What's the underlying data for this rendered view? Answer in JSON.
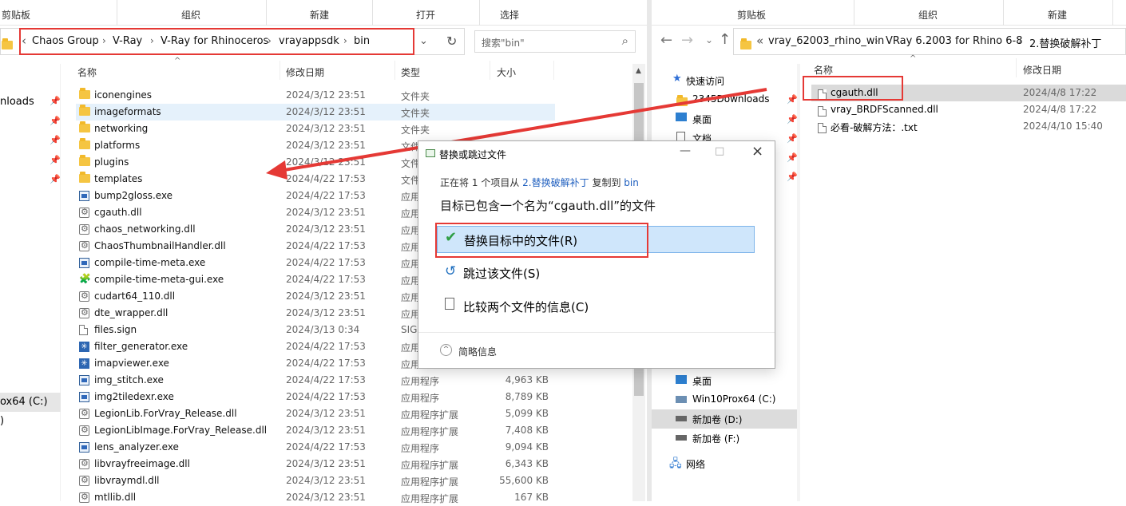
{
  "left_ribbon": {
    "clipboard": "剪贴板",
    "organize": "组织",
    "new": "新建",
    "open": "打开",
    "select": "选择"
  },
  "left_address": {
    "back": "‹",
    "items": [
      "Chaos Group",
      "V-Ray",
      "V-Ray for Rhinoceros",
      "vrayappsdk",
      "bin"
    ],
    "search_placeholder": "搜索\"bin\""
  },
  "left_headers": {
    "name": "名称",
    "date": "修改日期",
    "type": "类型",
    "size": "大小"
  },
  "left_nav": {
    "downloads": "nloads",
    "drive": "ox64 (C:)",
    "paren": ")"
  },
  "left_files": [
    {
      "name": "iconengines",
      "date": "2024/3/12 23:51",
      "type": "文件夹",
      "size": "",
      "icon": "folder-icon"
    },
    {
      "name": "imageformats",
      "date": "2024/3/12 23:51",
      "type": "文件夹",
      "size": "",
      "icon": "folder-icon"
    },
    {
      "name": "networking",
      "date": "2024/3/12 23:51",
      "type": "文件夹",
      "size": "",
      "icon": "folder-icon"
    },
    {
      "name": "platforms",
      "date": "2024/3/12 23:51",
      "type": "文件夹",
      "size": "",
      "icon": "folder-icon"
    },
    {
      "name": "plugins",
      "date": "2024/3/12 23:51",
      "type": "文件夹",
      "size": "",
      "icon": "folder-icon"
    },
    {
      "name": "templates",
      "date": "2024/4/22 17:53",
      "type": "文件",
      "size": "",
      "icon": "folder-icon"
    },
    {
      "name": "bump2gloss.exe",
      "date": "2024/4/22 17:53",
      "type": "应用",
      "size": "",
      "icon": "exe-icon"
    },
    {
      "name": "cgauth.dll",
      "date": "2024/3/12 23:51",
      "type": "应用",
      "size": "",
      "icon": "dll-icon"
    },
    {
      "name": "chaos_networking.dll",
      "date": "2024/3/12 23:51",
      "type": "应用",
      "size": "",
      "icon": "dll-icon"
    },
    {
      "name": "ChaosThumbnailHandler.dll",
      "date": "2024/4/22 17:53",
      "type": "应用",
      "size": "",
      "icon": "dll-icon"
    },
    {
      "name": "compile-time-meta.exe",
      "date": "2024/4/22 17:53",
      "type": "应用",
      "size": "",
      "icon": "exe-icon"
    },
    {
      "name": "compile-time-meta-gui.exe",
      "date": "2024/4/22 17:53",
      "type": "应用",
      "size": "",
      "icon": "gui-app-icon"
    },
    {
      "name": "cudart64_110.dll",
      "date": "2024/3/12 23:51",
      "type": "应用",
      "size": "",
      "icon": "dll-icon"
    },
    {
      "name": "dte_wrapper.dll",
      "date": "2024/3/12 23:51",
      "type": "应用",
      "size": "",
      "icon": "dll-icon"
    },
    {
      "name": "files.sign",
      "date": "2024/3/13 0:34",
      "type": "SIG",
      "size": "",
      "icon": "file-icon"
    },
    {
      "name": "filter_generator.exe",
      "date": "2024/4/22 17:53",
      "type": "应用",
      "size": "",
      "icon": "snowflake-icon"
    },
    {
      "name": "imapviewer.exe",
      "date": "2024/4/22 17:53",
      "type": "应用",
      "size": "",
      "icon": "snowflake-icon"
    },
    {
      "name": "img_stitch.exe",
      "date": "2024/4/22 17:53",
      "type": "应用程序",
      "size": "4,963 KB",
      "icon": "exe-icon"
    },
    {
      "name": "img2tiledexr.exe",
      "date": "2024/4/22 17:53",
      "type": "应用程序",
      "size": "8,789 KB",
      "icon": "exe-icon"
    },
    {
      "name": "LegionLib.ForVray_Release.dll",
      "date": "2024/3/12 23:51",
      "type": "应用程序扩展",
      "size": "5,099 KB",
      "icon": "dll-icon"
    },
    {
      "name": "LegionLibImage.ForVray_Release.dll",
      "date": "2024/3/12 23:51",
      "type": "应用程序扩展",
      "size": "7,408 KB",
      "icon": "dll-icon"
    },
    {
      "name": "lens_analyzer.exe",
      "date": "2024/4/22 17:53",
      "type": "应用程序",
      "size": "9,094 KB",
      "icon": "table-icon"
    },
    {
      "name": "libvrayfreeimage.dll",
      "date": "2024/3/12 23:51",
      "type": "应用程序扩展",
      "size": "6,343 KB",
      "icon": "dll-icon"
    },
    {
      "name": "libvraymdl.dll",
      "date": "2024/3/12 23:51",
      "type": "应用程序扩展",
      "size": "55,600 KB",
      "icon": "dll-icon"
    },
    {
      "name": "mtllib.dll",
      "date": "2024/3/12 23:51",
      "type": "应用程序扩展",
      "size": "167 KB",
      "icon": "dll-icon"
    }
  ],
  "right_ribbon": {
    "clipboard": "剪贴板",
    "organize": "组织",
    "new": "新建"
  },
  "right_address": {
    "items": [
      "vray_62003_rhino_win",
      "VRay 6.2003 for Rhino 6-8",
      "2.替换破解补丁"
    ]
  },
  "right_headers": {
    "name": "名称",
    "date": "修改日期"
  },
  "right_nav": [
    {
      "label": "快速访问",
      "icon": "star-icon"
    },
    {
      "label": "2345Downloads",
      "icon": "folder-icon"
    },
    {
      "label": "桌面",
      "icon": "desktop-icon"
    },
    {
      "label": "文档",
      "icon": "document-icon"
    },
    {
      "label": "桌面",
      "icon": "desktop-icon"
    },
    {
      "label": "Win10Prox64 (C:)",
      "icon": "drive-icon"
    },
    {
      "label": "新加卷 (D:)",
      "icon": "drive-icon"
    },
    {
      "label": "新加卷 (F:)",
      "icon": "drive-icon"
    },
    {
      "label": "网络",
      "icon": "network-icon"
    }
  ],
  "right_files": [
    {
      "name": "cgauth.dll",
      "date": "2024/4/8 17:22"
    },
    {
      "name": "vray_BRDFScanned.dll",
      "date": "2024/4/8 17:22"
    },
    {
      "name": "必看-破解方法：.txt",
      "date": "2024/4/10 15:40"
    }
  ],
  "dialog": {
    "title": "替换或跳过文件",
    "line1_prefix": "正在将",
    "line1_count": "1",
    "line1_mid": "个项目从",
    "line1_source": "2.替换破解补丁",
    "line1_copy": "复制到",
    "line1_dest": "bin",
    "line2": "目标已包含一个名为“cgauth.dll”的文件",
    "replace": "替换目标中的文件(R)",
    "skip": "跳过该文件(S)",
    "compare": "比较两个文件的信息(C)",
    "details": "简略信息"
  }
}
